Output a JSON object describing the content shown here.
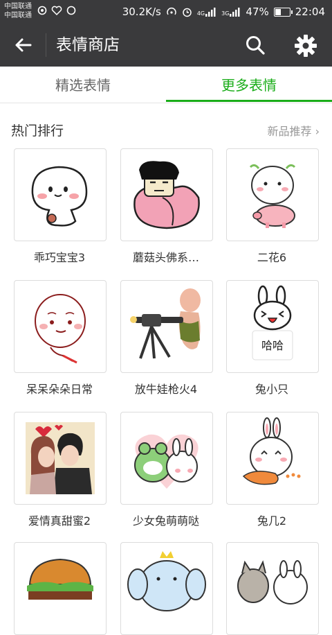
{
  "status_bar": {
    "carrier_1": "中国联通",
    "carrier_2": "中国联通",
    "speed": "30.2K/s",
    "signal_1": "4G",
    "signal_2": "3G",
    "battery": "47%",
    "battery_level": 0.47,
    "time": "22:04"
  },
  "app_bar": {
    "title": "表情商店"
  },
  "tabs": [
    {
      "label": "精选表情",
      "active": false
    },
    {
      "label": "更多表情",
      "active": true
    }
  ],
  "colors": {
    "accent": "#1aad19",
    "app_bar": "#3a3a3c"
  },
  "section": {
    "title": "热门排行",
    "more": "新品推荐 ›"
  },
  "stickers": [
    {
      "name": "乖巧宝宝3"
    },
    {
      "name": "蘑菇头佛系…"
    },
    {
      "name": "二花6"
    },
    {
      "name": "呆呆朵朵日常"
    },
    {
      "name": "放牛娃枪火4"
    },
    {
      "name": "兔小只",
      "caption": "哈哈"
    },
    {
      "name": "爱情真甜蜜2"
    },
    {
      "name": "少女兔萌萌哒"
    },
    {
      "name": "兔几2"
    },
    {
      "name": ""
    },
    {
      "name": ""
    },
    {
      "name": ""
    }
  ]
}
